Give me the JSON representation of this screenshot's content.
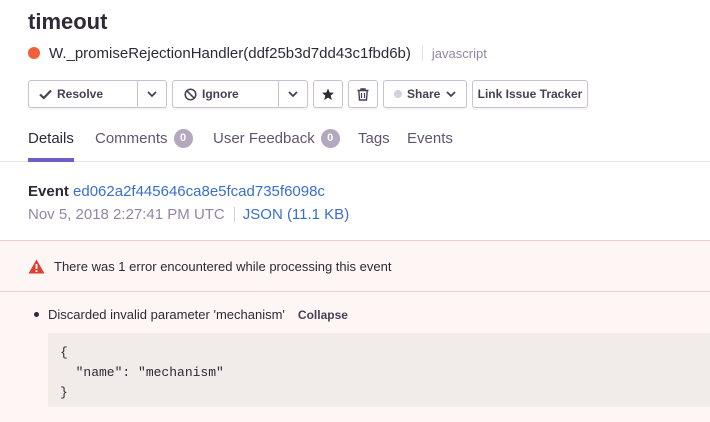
{
  "issue": {
    "title": "timeout",
    "culprit": "W._promiseRejectionHandler(ddf25b3d7dd43c1fbd6b)",
    "platform": "javascript",
    "level_color": "#f25f3a"
  },
  "toolbar": {
    "resolve_label": "Resolve",
    "ignore_label": "Ignore",
    "share_label": "Share",
    "link_tracker_label": "Link Issue Tracker"
  },
  "tabs": [
    {
      "label": "Details",
      "active": true
    },
    {
      "label": "Comments",
      "count": "0"
    },
    {
      "label": "User Feedback",
      "count": "0"
    },
    {
      "label": "Tags"
    },
    {
      "label": "Events"
    }
  ],
  "event": {
    "label": "Event",
    "id": "ed062a2f445646ca8e5fcad735f6098c",
    "date": "Nov 5, 2018 2:27:41 PM UTC",
    "json_link": "JSON (11.1 KB)"
  },
  "errors": {
    "header": "There was 1 error encountered while processing this event",
    "items": [
      {
        "text": "Discarded invalid parameter 'mechanism'",
        "toggle_label": "Collapse",
        "code": "{\n  \"name\": \"mechanism\"\n}"
      }
    ]
  },
  "colors": {
    "accent": "#6c5fc7",
    "link": "#3b6ecc",
    "error_icon": "#e03e2f"
  },
  "icons": {
    "resolve": "checkmark-icon",
    "ignore": "ignore-circle-icon",
    "bookmark": "star-icon",
    "delete": "trash-icon",
    "warning": "warning-triangle-icon"
  }
}
